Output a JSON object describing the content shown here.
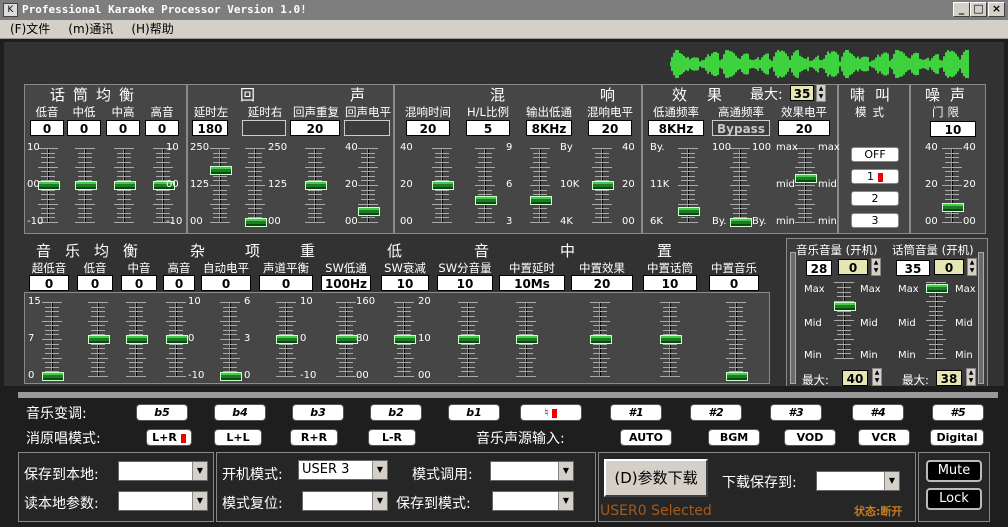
{
  "window": {
    "title": "Professional Karaoke Processor Version 1.0!",
    "app_icon": "K",
    "min": "_",
    "max": "□",
    "close": "×"
  },
  "menu": [
    "(F)文件",
    "(m)通讯",
    "(H)帮助"
  ],
  "sections": {
    "mic_eq": "话筒均衡",
    "echo": "回　声",
    "reverb": "混　响",
    "effect": "效果",
    "effect_max": "最大:",
    "effect_max_val": "35",
    "howl": "啸叫",
    "howl_mode": "模式",
    "noise": "噪声",
    "noise_gate": "门限",
    "music_eq": "音乐均衡",
    "misc": "杂项",
    "bass": "重低音",
    "center": "中置"
  },
  "mic_eq": {
    "labels": [
      "低音",
      "中低",
      "中高",
      "高音"
    ],
    "values": [
      "0",
      "0",
      "0",
      "0"
    ],
    "scale_l": [
      "10",
      "00",
      "-10"
    ],
    "scale_r": [
      "10",
      "00",
      "-10"
    ]
  },
  "echo": {
    "labels": [
      "延时左",
      "延时右",
      "回声重复",
      "回声电平"
    ],
    "values": [
      "180",
      "",
      "20",
      ""
    ],
    "scale1": [
      "250",
      "125",
      "00"
    ],
    "scale2": [
      "250",
      "125",
      "00"
    ],
    "scale3": [
      "40",
      "20",
      "00"
    ]
  },
  "reverb": {
    "labels": [
      "混响时间",
      "H/L比例",
      "输出低通",
      "混响电平"
    ],
    "values": [
      "20",
      "5",
      "8KHz",
      "20"
    ],
    "scale1": [
      "40",
      "20",
      "00"
    ],
    "scale2": [
      "9",
      "6",
      "3"
    ],
    "scale3": [
      "By",
      "10K",
      "4K"
    ],
    "scale4": [
      "40",
      "20",
      "00"
    ]
  },
  "effect": {
    "labels": [
      "低通频率",
      "高通频率",
      "效果电平"
    ],
    "values": [
      "8KHz",
      "Bypass",
      "20"
    ],
    "scale1": [
      "By.",
      "11K",
      "6K"
    ],
    "scale2": [
      "100",
      "",
      "By."
    ],
    "scale3": [
      "max",
      "mid",
      "min"
    ]
  },
  "howl": {
    "modes": [
      "OFF",
      "1",
      "2",
      "3"
    ]
  },
  "noise": {
    "value": "10",
    "scale": [
      "40",
      "20",
      "00"
    ]
  },
  "music": {
    "labels": [
      "超低音",
      "低音",
      "中音",
      "高音",
      "自动电平",
      "声道平衡",
      "SW低通",
      "SW衰减",
      "SW分音量",
      "中置延时",
      "中置效果",
      "中置话筒",
      "中置音乐"
    ],
    "values": [
      "0",
      "0",
      "0",
      "0",
      "0",
      "0",
      "100Hz",
      "10",
      "10",
      "10Ms",
      "20",
      "10",
      "0"
    ],
    "scale_a": [
      "15",
      "7",
      "0"
    ],
    "scale_b": [
      "10",
      "0",
      "-10"
    ],
    "scale_c": [
      "6",
      "3",
      "0"
    ],
    "scale_d": [
      "10",
      "0",
      "-10"
    ],
    "scale_e": [
      "160",
      "80",
      "00"
    ],
    "scale_f": [
      "20",
      "10",
      "00"
    ]
  },
  "volume": {
    "music_title": "音乐音量 (开机)",
    "mic_title": "话筒音量 (开机)",
    "music_val": "28",
    "music_boot": "0",
    "mic_val": "35",
    "mic_boot": "0",
    "max_lbl": "Max",
    "mid_lbl": "Mid",
    "min_lbl": "Min",
    "max_word": "最大:",
    "music_max": "40",
    "mic_max": "38"
  },
  "key": {
    "label": "音乐变调:",
    "buttons": [
      "b5",
      "b4",
      "b3",
      "b2",
      "b1",
      "♮",
      "#1",
      "#2",
      "#3",
      "#4",
      "#5"
    ]
  },
  "vocal": {
    "label": "消原唱模式:",
    "buttons": [
      "L+R",
      "L+L",
      "R+R",
      "L-R"
    ]
  },
  "source": {
    "label": "音乐声源输入:",
    "buttons": [
      "AUTO",
      "BGM",
      "VOD",
      "VCR",
      "Digital"
    ]
  },
  "controls": {
    "save_local": "保存到本地:",
    "read_local": "读本地参数:",
    "boot_mode": "开机模式:",
    "boot_val": "USER 3",
    "mode_reset": "模式复位:",
    "mode_call": "模式调用:",
    "save_mode": "保存到模式:",
    "download": "(D)参数下载",
    "download_save": "下载保存到:",
    "status_user": "USER0 Selected",
    "status_conn": "状态:断开",
    "mute": "Mute",
    "lock": "Lock"
  }
}
